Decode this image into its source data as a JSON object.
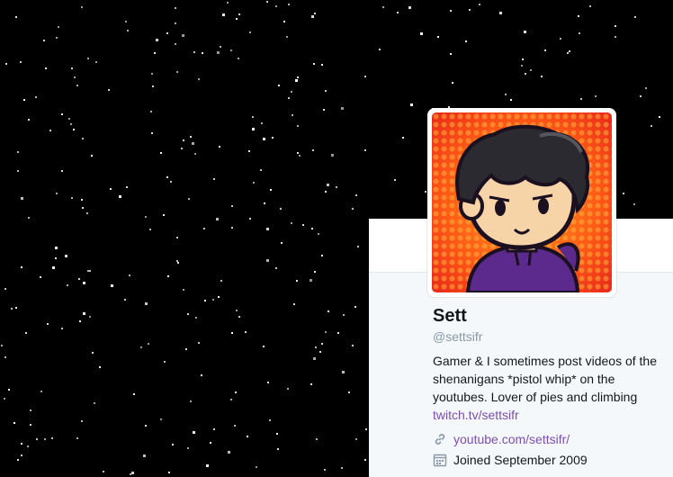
{
  "profile": {
    "display_name": "Sett",
    "screen_name": "@settsifr",
    "bio_text": "Gamer & I sometimes post videos of the shenanigans *pistol whip* on the youtubes. Lover of pies and climbing",
    "bio_link": "twitch.tv/settsifr",
    "website": "youtube.com/settsifr/",
    "joined": "Joined September 2009",
    "avatar_icon": "avatar-cartoon-icon",
    "link_icon": "link-icon",
    "calendar_icon": "calendar-icon"
  },
  "colors": {
    "link": "#7b4fb0",
    "panel_bg": "#f5f8fa",
    "muted_text": "#8899a6",
    "header_bg": "#000000"
  }
}
